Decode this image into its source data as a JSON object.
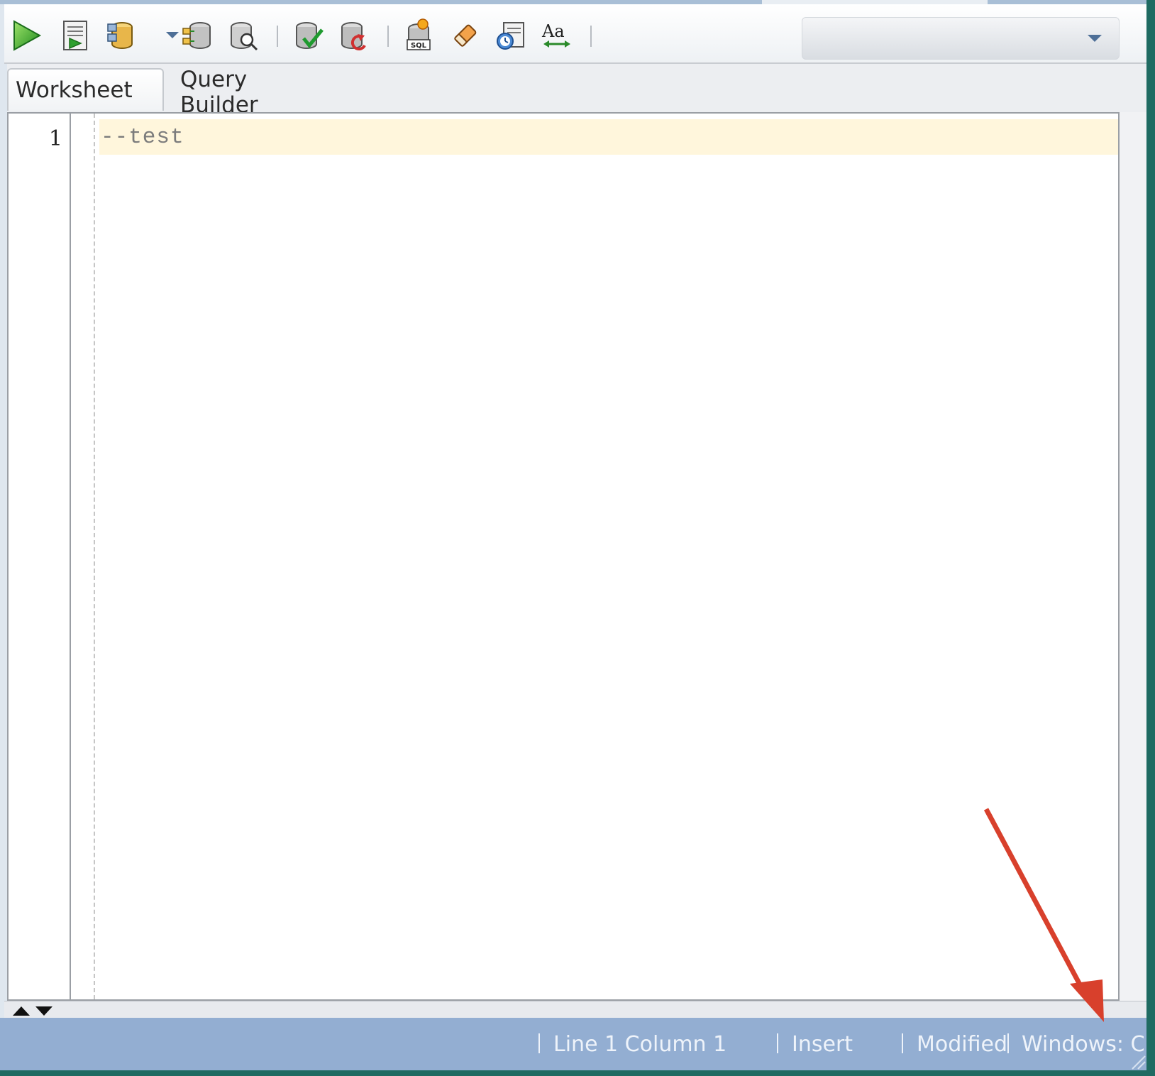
{
  "toolbar": {
    "items": [
      {
        "name": "run-statement-icon"
      },
      {
        "name": "run-script-icon"
      },
      {
        "name": "autotrace-icon"
      },
      {
        "name": "explain-plan-icon"
      },
      {
        "name": "sql-tuning-icon"
      },
      {
        "name": "commit-icon"
      },
      {
        "name": "rollback-icon"
      },
      {
        "name": "unshared-worksheet-icon"
      },
      {
        "name": "clear-icon"
      },
      {
        "name": "sql-history-icon"
      },
      {
        "name": "format-case-icon"
      }
    ],
    "connection_value": ""
  },
  "tabs": [
    {
      "label": "Worksheet",
      "active": true
    },
    {
      "label": "Query Builder",
      "active": false
    }
  ],
  "editor": {
    "lines": [
      {
        "number": "1",
        "text": "--test"
      }
    ]
  },
  "status_bar": {
    "position": "Line 1 Column 1",
    "mode": "Insert",
    "state": "Modified",
    "encoding": "Windows: CR"
  },
  "colors": {
    "status_bar": "#93aed2",
    "current_line": "#fff6dc",
    "annotation_arrow": "#d8402c"
  }
}
